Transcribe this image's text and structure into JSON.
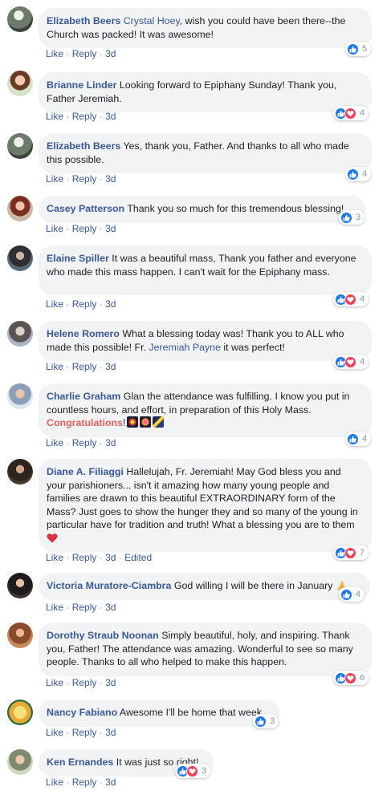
{
  "actions": {
    "like": "Like",
    "reply": "Reply",
    "dot": "·"
  },
  "colors": {
    "link": "#385898",
    "like_blue": "#1877f2",
    "love_red": "#f33e58",
    "bubble": "#f2f3f5"
  },
  "comments": [
    {
      "author": "Elizabeth Beers",
      "mention": "Crystal Hoey",
      "text": ", wish you could have been there--the Church was packed! It was awesome!",
      "time": "3d",
      "reactions": [
        "like"
      ],
      "count": "5"
    },
    {
      "author": "Brianne Linder",
      "text": "Looking forward to Epiphany Sunday! Thank you, Father Jeremiah.",
      "time": "3d",
      "reactions": [
        "like",
        "love"
      ],
      "count": "4"
    },
    {
      "author": "Elizabeth Beers",
      "text": "Yes, thank you, Father. And thanks to all who made this possible.",
      "time": "3d",
      "reactions": [
        "like"
      ],
      "count": "4"
    },
    {
      "author": "Casey Patterson",
      "text": "Thank you so much for this tremendous blessing!",
      "time": "3d",
      "reactions": [
        "like"
      ],
      "count": "3"
    },
    {
      "author": "Elaine Spiller",
      "text": "It was a beautiful mass, Thank you father and everyone who made this mass happen. I can't wait for the Epiphany mass.",
      "time": "3d",
      "reactions": [
        "like",
        "love"
      ],
      "count": "4"
    },
    {
      "author": "Helene Romero",
      "text": "What a blessing today was! Thank you to ALL who made this possible! Fr.",
      "mention": "Jeremiah Payne",
      "text_after": "it was perfect!",
      "time": "3d",
      "reactions": [
        "like",
        "love"
      ],
      "count": "4"
    },
    {
      "author": "Charlie Graham",
      "text": "Glan the attendance was fulfilling. I know you put in countless hours, and effort, in preparation of this Holy Mass.",
      "highlight": "Congratulations",
      "highlight_after": "!",
      "emojis": [
        "fireworks-emoji",
        "fireworks-sparkle-emoji",
        "shooting-star-emoji"
      ],
      "time": "3d",
      "reactions": [
        "like"
      ],
      "count": "4"
    },
    {
      "author": "Diane A. Filiaggi",
      "text": "Hallelujah, Fr. Jeremiah! May God bless you and your parishioners... isn't it amazing how many young people and families are drawn to this beautiful EXTRAORDINARY form of the Mass? Just goes to show the hunger they and so many of the young in particular have for tradition and truth! What a blessing you are to them",
      "emojis": [
        "red-heart-emoji"
      ],
      "time": "3d",
      "edited": "Edited",
      "reactions": [
        "like",
        "love"
      ],
      "count": "7"
    },
    {
      "author": "Victoria Muratore-Ciambra",
      "text": "God willing I will be there in January",
      "emojis": [
        "praying-hands-emoji"
      ],
      "time": "3d",
      "reactions": [
        "like"
      ],
      "count": "4"
    },
    {
      "author": "Dorothy Straub Noonan",
      "text": "Simply beautiful, holy, and inspiring. Thank you, Father! The attendance was amazing. Wonderful to see so many people. Thanks to all who helped to make this happen.",
      "time": "3d",
      "reactions": [
        "like",
        "love"
      ],
      "count": "6"
    },
    {
      "author": "Nancy Fabiano",
      "text": "Awesome I'll be home that week",
      "time": "3d",
      "reactions": [
        "like"
      ],
      "count": "3"
    },
    {
      "author": "Ken Ernandes",
      "text": "It was just so right!",
      "time": "3d",
      "reactions": [
        "like",
        "love"
      ],
      "count": "3"
    }
  ]
}
